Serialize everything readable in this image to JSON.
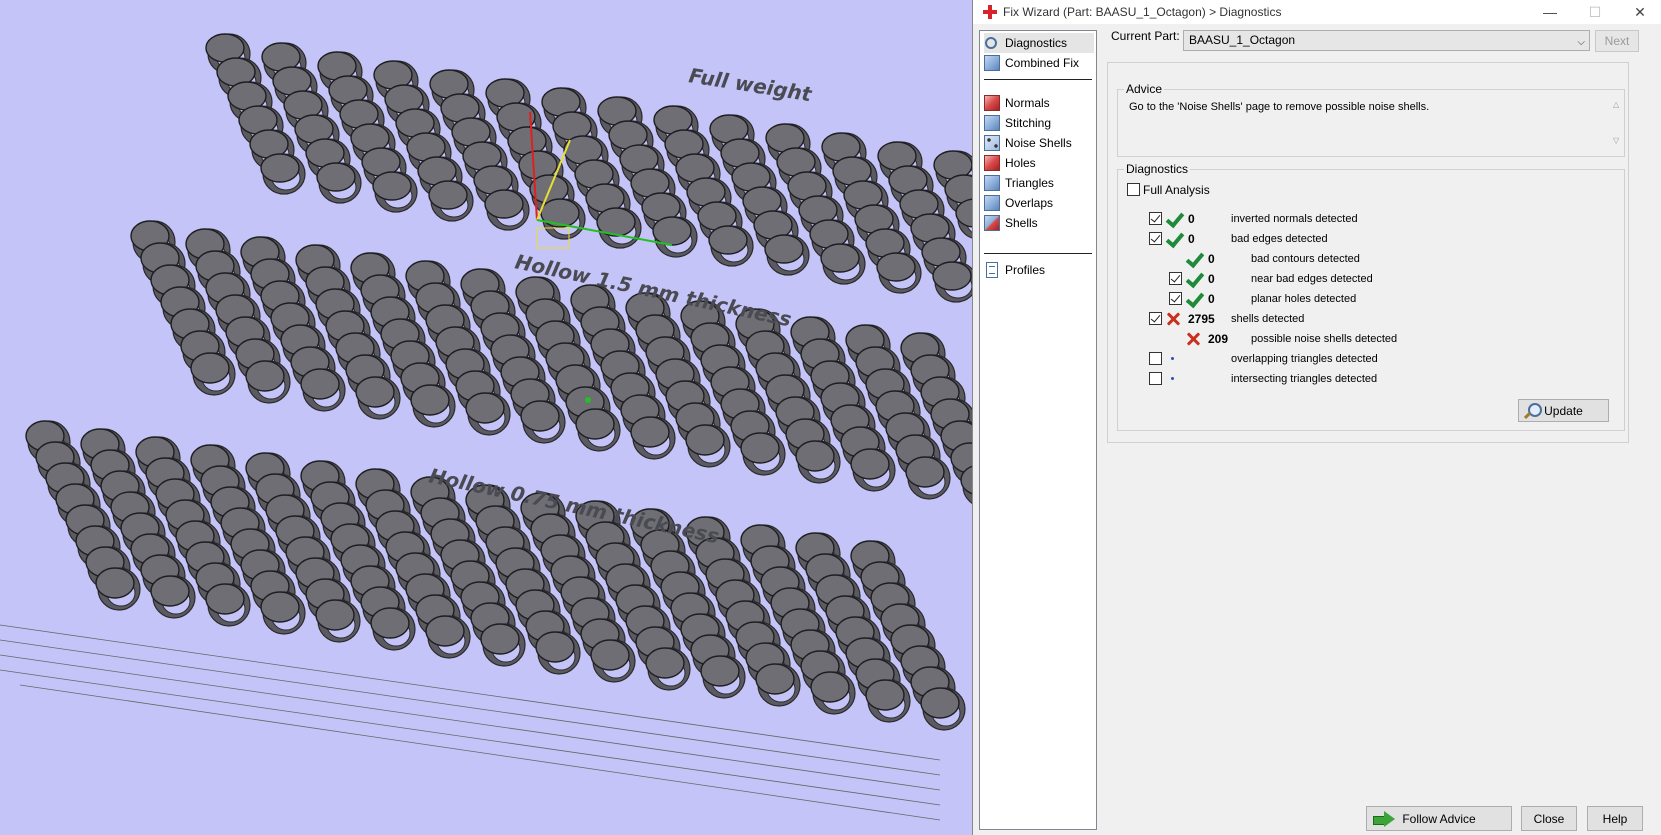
{
  "viewport": {
    "label_full_weight": "Full weight",
    "label_hollow_15": "Hollow 1.5 mm thickness",
    "label_hollow_075": "Hollow 0.75 mm thickness"
  },
  "window": {
    "title": "Fix Wizard (Part: BAASU_1_Octagon) > Diagnostics",
    "minimize": "—",
    "maximize": "☐",
    "close": "✕"
  },
  "nav": {
    "items": [
      {
        "label": "Diagnostics",
        "icon": "magnifier-icon",
        "selected": true
      },
      {
        "label": "Combined Fix",
        "icon": "cube-icon"
      },
      {
        "label": "Normals",
        "icon": "cube-red-icon"
      },
      {
        "label": "Stitching",
        "icon": "cube-icon"
      },
      {
        "label": "Noise Shells",
        "icon": "cube-dots-icon"
      },
      {
        "label": "Holes",
        "icon": "cube-red-icon"
      },
      {
        "label": "Triangles",
        "icon": "cube-icon"
      },
      {
        "label": "Overlaps",
        "icon": "cube-icon"
      },
      {
        "label": "Shells",
        "icon": "cube-mixed-icon"
      },
      {
        "label": "Profiles",
        "icon": "document-icon"
      }
    ]
  },
  "current_part": {
    "label": "Current Part:",
    "value": "BAASU_1_Octagon",
    "next_label": "Next"
  },
  "advice": {
    "title": "Advice",
    "text": "Go to the 'Noise Shells' page to remove possible noise shells."
  },
  "diagnostics": {
    "title": "Diagnostics",
    "full_analysis_label": "Full Analysis",
    "full_analysis_checked": false,
    "rows": [
      {
        "checked": true,
        "status": "ok",
        "count": "0",
        "label": "inverted normals detected"
      },
      {
        "checked": true,
        "status": "ok",
        "count": "0",
        "label": "bad edges detected"
      },
      {
        "status": "ok",
        "count": "0",
        "label": "bad contours detected"
      },
      {
        "checked": true,
        "status": "ok",
        "count": "0",
        "label": "near bad edges detected"
      },
      {
        "checked": true,
        "status": "ok",
        "count": "0",
        "label": "planar holes detected"
      },
      {
        "checked": true,
        "status": "bad",
        "count": "2795",
        "label": "shells detected"
      },
      {
        "status": "bad",
        "count": "209",
        "label": "possible noise shells detected"
      },
      {
        "checked": false,
        "status": "pending",
        "count": "",
        "label": "overlapping triangles detected"
      },
      {
        "checked": false,
        "status": "pending",
        "count": "",
        "label": "intersecting triangles detected"
      }
    ],
    "update_label": "Update"
  },
  "footer": {
    "follow_advice": "Follow Advice",
    "close": "Close",
    "help": "Help"
  }
}
